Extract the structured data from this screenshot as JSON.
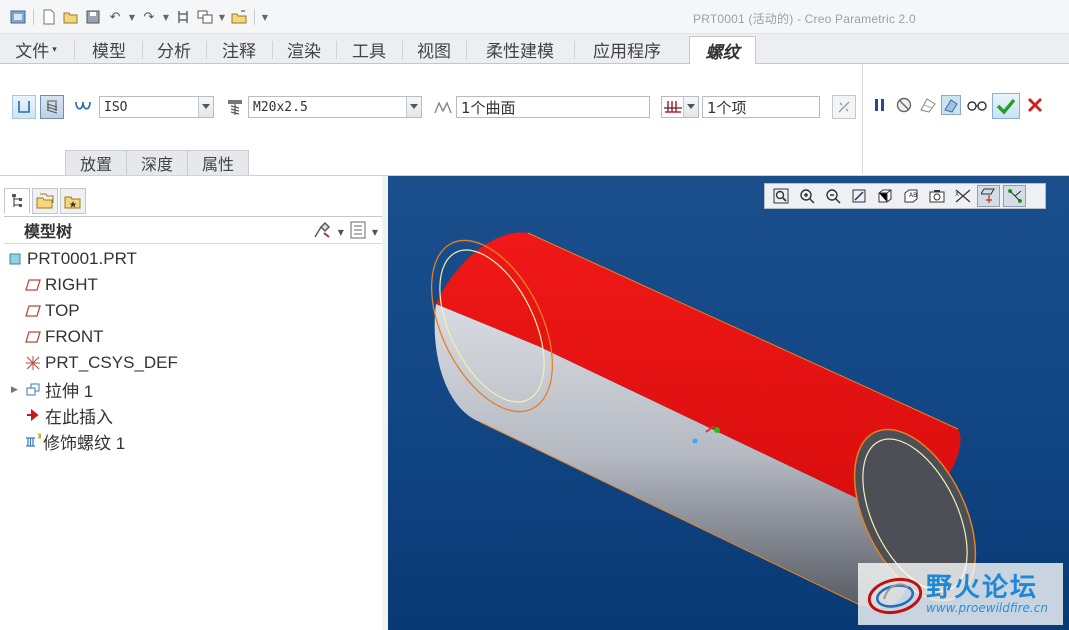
{
  "window": {
    "title": "PRT0001 (活动的) - Creo Parametric 2.0"
  },
  "ribbon": {
    "tabs": [
      "文件",
      "模型",
      "分析",
      "注释",
      "渲染",
      "工具",
      "视图",
      "柔性建模",
      "应用程序",
      "螺纹"
    ],
    "active_tab": "螺纹"
  },
  "thread_dashboard": {
    "standard": "ISO",
    "thread_size": "M20x2.5",
    "surface_collector": "1个曲面",
    "start_collector": "1个项",
    "subtabs": [
      "放置",
      "深度",
      "属性"
    ]
  },
  "model_tree": {
    "title": "模型树",
    "items": [
      {
        "label": "PRT0001.PRT",
        "icon": "part-icon"
      },
      {
        "label": "RIGHT",
        "icon": "datum-plane-icon"
      },
      {
        "label": "TOP",
        "icon": "datum-plane-icon"
      },
      {
        "label": "FRONT",
        "icon": "datum-plane-icon"
      },
      {
        "label": "PRT_CSYS_DEF",
        "icon": "csys-icon"
      },
      {
        "label": "拉伸 1",
        "icon": "extrude-icon"
      },
      {
        "label": "在此插入",
        "icon": "insert-here-icon"
      },
      {
        "label": "修饰螺纹 1",
        "icon": "cosmetic-thread-icon"
      }
    ]
  },
  "watermark": {
    "title": "野火论坛",
    "url": "www.proewildfire.cn"
  },
  "colors": {
    "viewport_bg": "#124685",
    "highlight_red": "#e30613",
    "cylinder_gray": "#b8bcc4",
    "accent_green": "#2c9b2c",
    "cancel_red": "#d21c1c"
  }
}
